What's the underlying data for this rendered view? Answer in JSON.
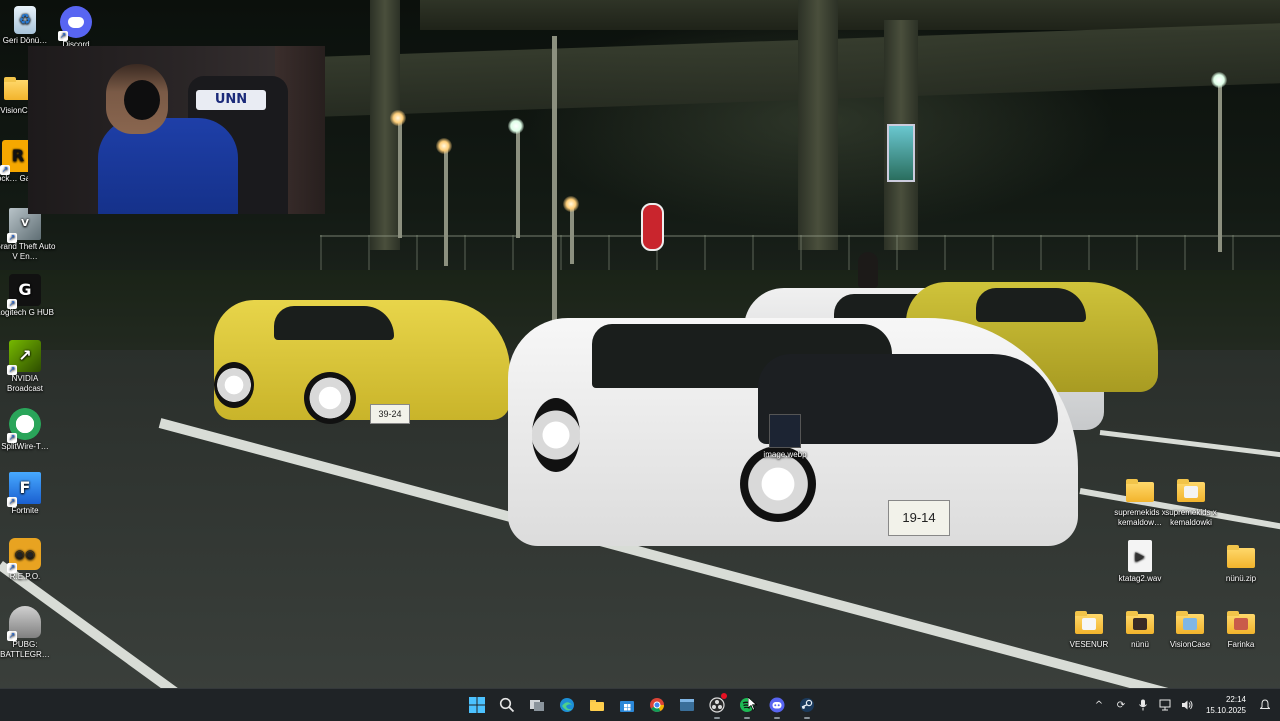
{
  "desktop": {
    "left_icons": [
      {
        "id": "recycle-bin",
        "label": "Geri Dönü…",
        "icon": "recycle-bin-icon"
      },
      {
        "id": "discord",
        "label": "Discord",
        "icon": "discord-icon"
      },
      {
        "id": "visionc",
        "label": "VisionC…",
        "icon": "folder-icon"
      },
      {
        "id": "rockstar",
        "label": "Rock… Gam…",
        "icon": "rockstar-games-icon"
      },
      {
        "id": "gta",
        "label": "Grand Theft Auto V En…",
        "icon": "gta-v-icon"
      },
      {
        "id": "logitech",
        "label": "Logitech G HUB",
        "icon": "logitech-g-hub-icon"
      },
      {
        "id": "nvidia",
        "label": "NVIDIA Broadcast",
        "icon": "nvidia-broadcast-icon"
      },
      {
        "id": "splitwire",
        "label": "SplitWire-T…",
        "icon": "splitwire-icon"
      },
      {
        "id": "fortnite",
        "label": "Fortnite",
        "icon": "fortnite-icon"
      },
      {
        "id": "repo",
        "label": "R.E.P.O.",
        "icon": "repo-game-icon"
      },
      {
        "id": "pubg",
        "label": "PUBG: BATTLEGR…",
        "icon": "pubg-icon"
      }
    ],
    "right_icons": [
      {
        "id": "supremekids1",
        "label": "supremekids x kemaldow…",
        "icon": "folder-icon"
      },
      {
        "id": "supremekids2",
        "label": "supremekids x kemaldowki",
        "icon": "folder-icon"
      },
      {
        "id": "ktatag2",
        "label": "ktatag2.wav",
        "icon": "audio-file-icon"
      },
      {
        "id": "nunu-zip",
        "label": "nünü.zip",
        "icon": "zip-folder-icon"
      },
      {
        "id": "vesenur",
        "label": "VESENUR",
        "icon": "folder-icon"
      },
      {
        "id": "nunu",
        "label": "nünü",
        "icon": "folder-icon"
      },
      {
        "id": "visioncase",
        "label": "VisionCase",
        "icon": "folder-icon"
      },
      {
        "id": "farinka",
        "label": "Farinka",
        "icon": "folder-icon"
      }
    ],
    "center_icon": {
      "id": "image-webp",
      "label": "image.webp",
      "icon": "image-file-icon"
    }
  },
  "webcam": {
    "chair_text": "UNN"
  },
  "wallpaper": {
    "plate_left": "39-24",
    "plate_right": "19-14"
  },
  "taskbar": {
    "apps": [
      {
        "id": "start",
        "icon": "windows-start-icon",
        "running": false
      },
      {
        "id": "search",
        "icon": "search-icon",
        "running": false
      },
      {
        "id": "task-view",
        "icon": "task-view-icon",
        "running": false
      },
      {
        "id": "edge",
        "icon": "edge-browser-icon",
        "running": false
      },
      {
        "id": "explorer",
        "icon": "file-explorer-icon",
        "running": false
      },
      {
        "id": "store",
        "icon": "microsoft-store-icon",
        "running": false
      },
      {
        "id": "chrome",
        "icon": "chrome-icon",
        "running": false
      },
      {
        "id": "app-window",
        "icon": "app-window-icon",
        "running": false
      },
      {
        "id": "obs",
        "icon": "obs-icon",
        "running": true,
        "badge": true
      },
      {
        "id": "spotify",
        "icon": "spotify-icon",
        "running": true
      },
      {
        "id": "discord",
        "icon": "discord-icon",
        "running": true
      },
      {
        "id": "steam",
        "icon": "steam-icon",
        "running": true
      }
    ],
    "tray": {
      "chevron": "^",
      "time": "22:14",
      "date": "15.10.2025"
    }
  },
  "colors": {
    "taskbar_bg": "#1f2326",
    "folder": "#f2b42c",
    "discord": "#5865f2",
    "accent": "#0078d4"
  }
}
